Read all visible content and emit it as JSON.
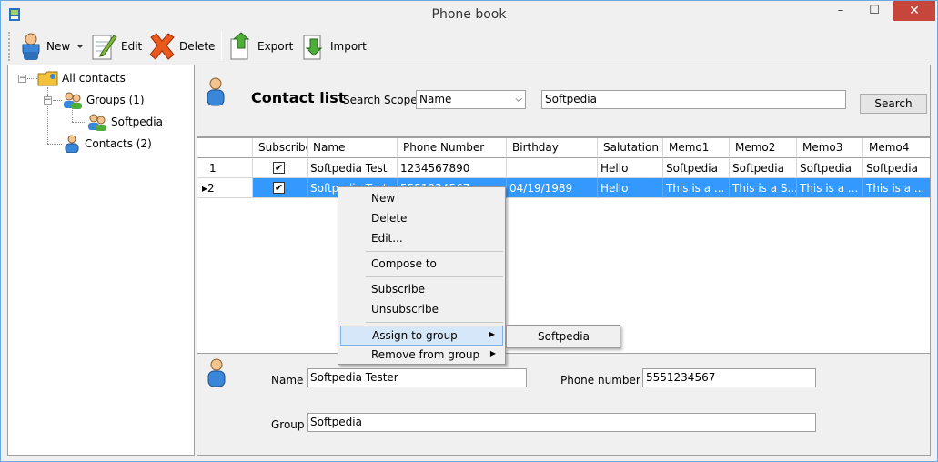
{
  "window": {
    "title": "Phone book",
    "minimize_glyph": "–",
    "maximize_glyph": "☐",
    "close_glyph": "✕"
  },
  "toolbar": {
    "new_label": "New",
    "edit_label": "Edit",
    "delete_label": "Delete",
    "export_label": "Export",
    "import_label": "Import",
    "icons": [
      "user-icon",
      "dropdown-arrow-icon",
      "notepad-pencil-icon",
      "red-x-icon",
      "export-arrow-icon",
      "import-arrow-icon"
    ]
  },
  "tree": {
    "root": {
      "label": "All contacts",
      "icon": "folder-contacts-icon",
      "expander": "⊟"
    },
    "groups": {
      "label": "Groups (1)",
      "icon": "group-icon",
      "expander": "⊟"
    },
    "group_item": {
      "label": "Softpedia",
      "icon": "group-icon"
    },
    "contacts": {
      "label": "Contacts (2)",
      "icon": "user-icon"
    }
  },
  "search": {
    "title": "Contact list",
    "scope_label": "Search Scope",
    "scope_value": "Name",
    "query": "Softpedia",
    "button_label": "Search"
  },
  "grid": {
    "columns": [
      "",
      "Subscribe",
      "Name",
      "Phone Number",
      "Birthday",
      "Salutation",
      "Memo1",
      "Memo2",
      "Memo3",
      "Memo4"
    ],
    "rows": [
      {
        "num": "1",
        "subscribe": "✔",
        "name": "Softpedia Test",
        "phone": "1234567890",
        "birthday": "",
        "salutation": "Hello",
        "memo1": "Softpedia",
        "memo2": "Softpedia",
        "memo3": "Softpedia",
        "memo4": "Softpedia"
      },
      {
        "num": "2",
        "marker": "▸",
        "subscribe": "✔",
        "name": "Softpedia Tester",
        "phone": "5551234567",
        "birthday": "04/19/1989",
        "salutation": "Hello",
        "memo1": "This is a ...",
        "memo2": "This is a S...",
        "memo3": "This is a ...",
        "memo4": "This is a ..."
      }
    ]
  },
  "context_menu": {
    "items": [
      "New",
      "Delete",
      "Edit...",
      "Compose to",
      "Subscribe",
      "Unsubscribe",
      "Assign to group",
      "Remove from group"
    ],
    "submenu_arrow": "▶",
    "submenu_items": [
      "Softpedia"
    ]
  },
  "detail": {
    "name_label": "Name",
    "name_value": "Softpedia Tester",
    "phone_label": "Phone number",
    "phone_value": "5551234567",
    "group_label": "Group",
    "group_value": "Softpedia"
  },
  "colors": {
    "selection": "#3399ff",
    "menu_highlight": "#d5e7f8",
    "close_button": "#c7453a"
  }
}
